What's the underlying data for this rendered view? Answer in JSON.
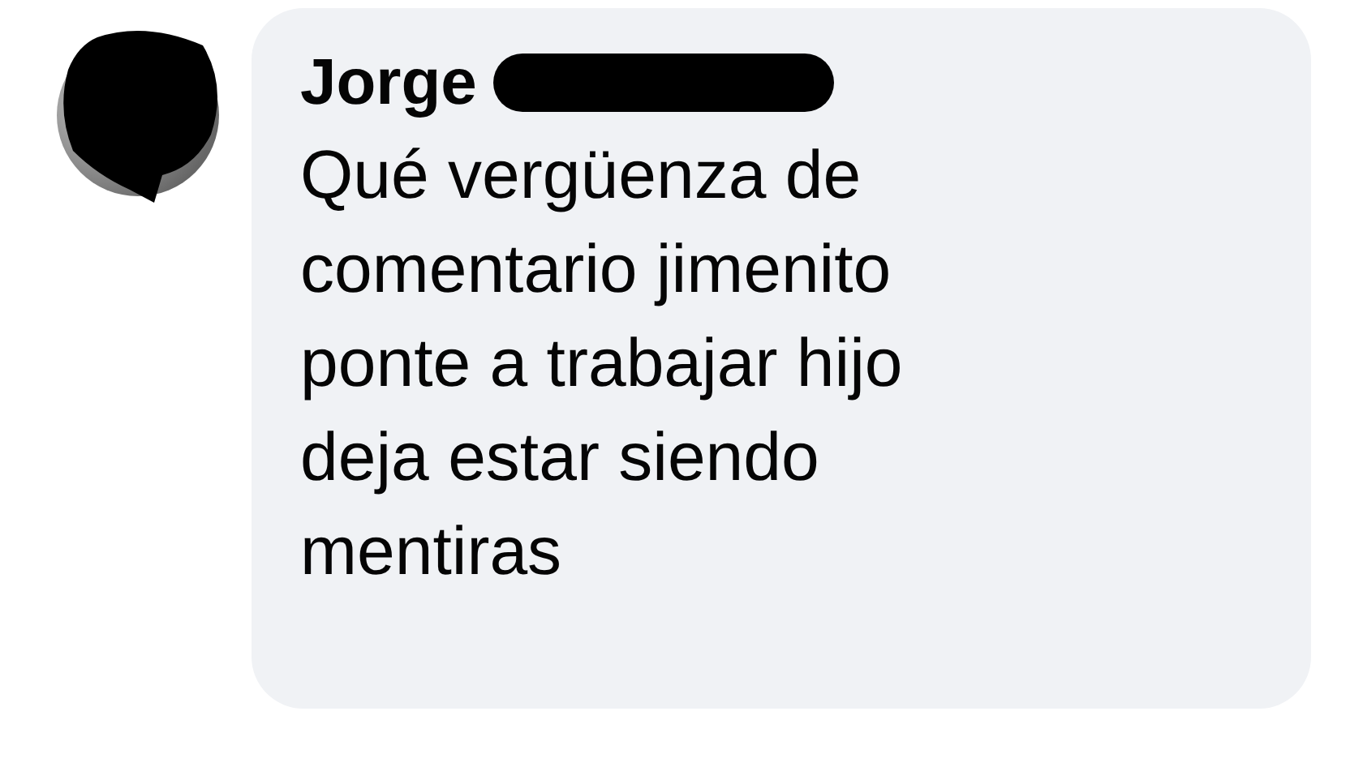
{
  "comment": {
    "author": "Jorge",
    "author_redacted": true,
    "text": "Qué vergüenza de comentario jimenito ponte a trabajar hijo deja estar siendo mentiras"
  }
}
